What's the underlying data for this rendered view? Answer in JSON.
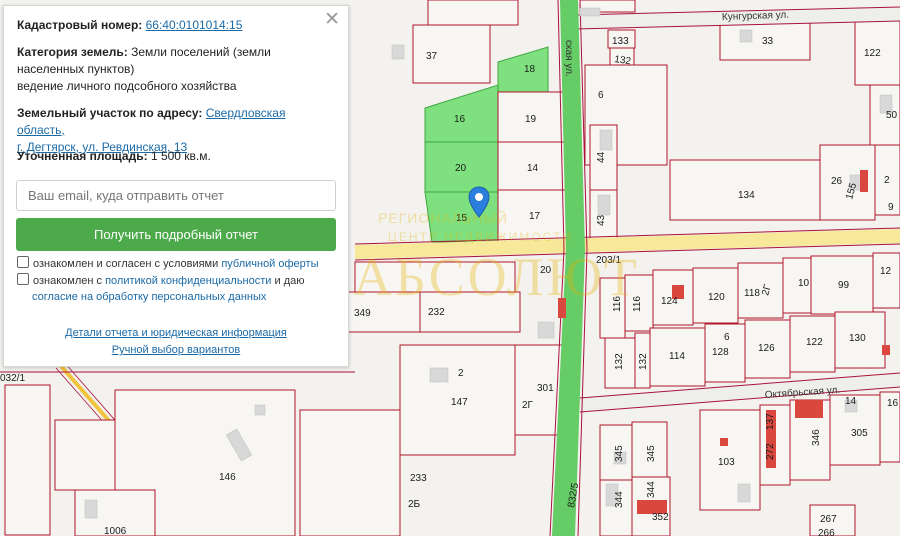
{
  "panel": {
    "cadastral_label": "Кадастровый номер:",
    "cadastral_number": "66:40:0101014:15",
    "category_label": "Категория земель:",
    "category_value_line1": "Земли поселений (земли",
    "category_value_line2": "населенных пунктов)",
    "category_value_line3": "ведение личного подсобного хозяйства",
    "address_label": "Земельный участок по адресу:",
    "address_line1": "Свердловская область,",
    "address_line2": "г. Дегтярск, ул. Ревдинская, 13",
    "area_label": "Уточненная площадь:",
    "area_value": "1 500 кв.м.",
    "email_placeholder": "Ваш email, куда отправить отчет",
    "submit_label": "Получить подробный отчет",
    "consent1_text": "ознакомлен и согласен с условиями ",
    "consent1_link": "публичной оферты",
    "consent2_text": "ознакомлен с ",
    "consent2_link1": "политикой конфиденциальности",
    "consent2_mid": " и даю",
    "consent2_link2": "согласие на обработку персональных данных",
    "details_link": "Детали отчета и юридическая информация",
    "manual_link": "Ручной выбор вариантов",
    "close_symbol": "✕"
  },
  "watermark": {
    "line1": "РЕГИОНАЛЬНЫЙ",
    "line2": "ЦЕНТР НЕДВИЖИМОСТИ",
    "line3": "АБСОЛЮТ"
  },
  "map": {
    "streets": {
      "kungurskaya": "Кунгурская ул.",
      "oktyabrskaya": "Октябрьская ул.",
      "revdinskaya_fragment": "ская ул."
    },
    "road_labels": {
      "r203": "203/1",
      "r832": "832/5",
      "r032": "032/1"
    },
    "plot_labels": {
      "p37": "37",
      "p18": "18",
      "p16": "16",
      "p19": "19",
      "p20": "20",
      "p14": "14",
      "p15": "15",
      "p17": "17",
      "p133": "133",
      "p132top": "132",
      "p6": "6",
      "p44": "44",
      "p43": "43",
      "p33": "33",
      "p122top": "122",
      "p50": "50",
      "p134": "134",
      "p26": "26",
      "p155": "155",
      "p2": "2",
      "p9": "9",
      "p20b": "20",
      "p349": "349",
      "p232": "232",
      "p116": "116",
      "p124": "124",
      "p120": "120",
      "p118": "118",
      "p2z": "2Г",
      "p10": "10",
      "p99": "99",
      "p12": "12",
      "p132a": "132",
      "p132b": "132",
      "p114": "114",
      "p6b": "6",
      "p128": "128",
      "p126": "126",
      "p122": "122",
      "p130": "130",
      "p2c": "2",
      "p147": "147",
      "p301": "301",
      "p2g": "2Г",
      "p14b": "14",
      "p16b": "16",
      "p137": "137",
      "p272": "272",
      "p346": "346",
      "p305": "305",
      "p345a": "345",
      "p345b": "345",
      "p103": "103",
      "p146": "146",
      "p233": "233",
      "p2b": "2Б",
      "p344a": "344",
      "p344b": "344",
      "p352": "352",
      "p1006": "1006",
      "p267": "267",
      "p266": "266"
    }
  },
  "colors": {
    "selected_plot": "#7fe07f",
    "road": "#66cc66",
    "plot_border": "#b0152a",
    "button": "#4daa4a",
    "link": "#1b6aa6"
  }
}
